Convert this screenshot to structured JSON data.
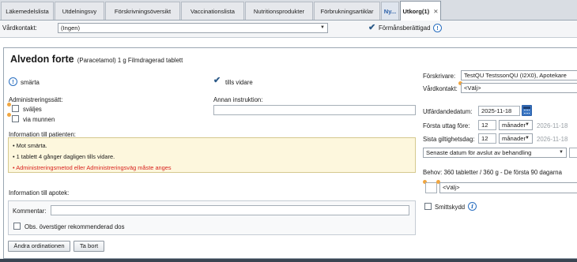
{
  "tabs": [
    {
      "label": "Läkemedelslista"
    },
    {
      "label": "Utdelningsvy"
    },
    {
      "label": "Förskrivningsöversikt"
    },
    {
      "label": "Vaccinationslista"
    },
    {
      "label": "Nutritionsprodukter"
    },
    {
      "label": "Förbrukningsartiklar"
    },
    {
      "label": "Ny..."
    },
    {
      "label": "Utkorg(1)",
      "close": "✕"
    }
  ],
  "header": {
    "vardkontakt_label": "Vårdkontakt:",
    "vardkontakt_value": "(Ingen)",
    "formansberattigad_label": "Förmånsberättigad",
    "formansberattigad_checked": true
  },
  "drug": {
    "name": "Alvedon forte",
    "detail": "(Paracetamol) 1 g Filmdragerad tablett"
  },
  "indication": "smärta",
  "tills_vidare": {
    "label": "tills vidare",
    "checked": true
  },
  "admin": {
    "label": "Administreringssätt:",
    "options": [
      "sväljes",
      "via munnen"
    ]
  },
  "annan_instruktion": {
    "label": "Annan instruktion:",
    "value": ""
  },
  "patient_info": {
    "label": "Information till patienten:",
    "lines": [
      "• Mot smärta.",
      "• 1 tablett 4 gånger dagligen tills vidare."
    ],
    "error": "• Administreringsmetod eller Administreringsväg måste anges"
  },
  "apotek": {
    "label": "Information till apotek:",
    "kommentar_label": "Kommentar:",
    "kommentar_value": "",
    "obs_label": "Obs. överstiger rekommenderad dos"
  },
  "buttons": {
    "andra": "Ändra ordinationen",
    "tabort": "Ta bort"
  },
  "right": {
    "forskrivare_label": "Förskrivare:",
    "forskrivare_value": "TestQU TestssonQU (I2X0), Apotekare",
    "vardkontakt_label": "Vårdkontakt:",
    "vardkontakt_value": "<Välj>",
    "utfardande_label": "Utfärdandedatum:",
    "utfardande_value": "2025-11-18",
    "forsta_label": "Första uttag före:",
    "forsta_num": "12",
    "forsta_unit": "månader",
    "forsta_date": "2026-11-18",
    "sista_label": "Sista giltighetsdag:",
    "sista_num": "12",
    "sista_unit": "månader",
    "sista_date": "2026-11-18",
    "senaste_value": "Senaste datum för avslut av behandling",
    "behov_label": "Behov: 360 tabletter / 360 g - De första 90 dagarna",
    "behov_select": "<Välj>",
    "smittskydd_label": "Smittskydd"
  },
  "colors": {
    "accent": "#2a6fc0",
    "error": "#d9231e",
    "warning_dot": "#f0a640",
    "infobox": "#fdf7dd"
  },
  "icons": {
    "info": "info-circle-icon",
    "calendar": "calendar-icon",
    "close": "close-icon",
    "dropdown": "chevron-down-icon"
  }
}
